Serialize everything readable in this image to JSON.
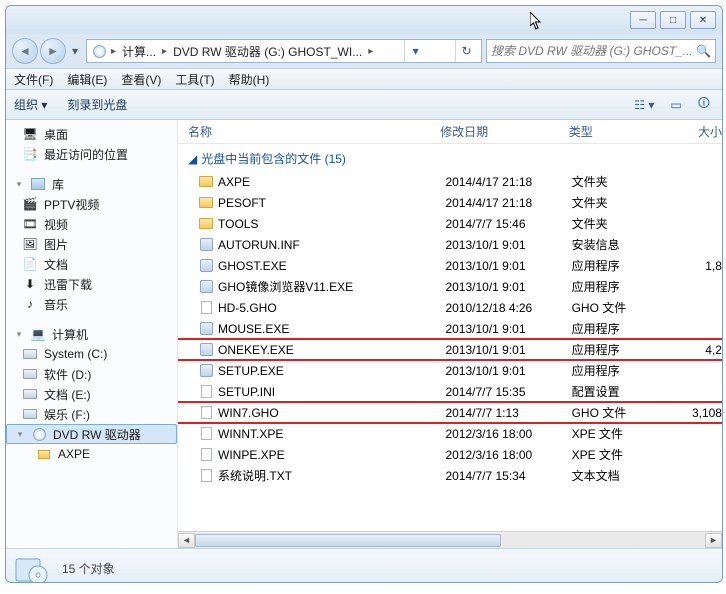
{
  "breadcrumb": {
    "seg1": "计算...",
    "seg2": "DVD RW 驱动器 (G:) GHOST_WI..."
  },
  "search": {
    "placeholder": "搜索 DVD RW 驱动器 (G:) GHOST_..."
  },
  "menu": {
    "file": "文件(F)",
    "edit": "编辑(E)",
    "view": "查看(V)",
    "tools": "工具(T)",
    "help": "帮助(H)"
  },
  "toolbar": {
    "organize": "组织",
    "burn": "刻录到光盘"
  },
  "sidebar": {
    "desktop": "桌面",
    "recent": "最近访问的位置",
    "lib": "库",
    "pptv": "PPTV视频",
    "video": "视频",
    "pictures": "图片",
    "docs": "文档",
    "xunlei": "迅雷下载",
    "music": "音乐",
    "computer": "计算机",
    "sysc": "System (C:)",
    "softd": "软件 (D:)",
    "doce": "文档 (E:)",
    "entf": "娱乐 (F:)",
    "dvdg": "DVD RW 驱动器",
    "axpe": "AXPE"
  },
  "columns": {
    "name": "名称",
    "date": "修改日期",
    "type": "类型",
    "size": "大小"
  },
  "group": {
    "label": "光盘中当前包含的文件 (15)"
  },
  "files": [
    {
      "icon": "folder",
      "name": "AXPE",
      "date": "2014/4/17 21:18",
      "type": "文件夹",
      "size": ""
    },
    {
      "icon": "folder",
      "name": "PESOFT",
      "date": "2014/4/17 21:18",
      "type": "文件夹",
      "size": ""
    },
    {
      "icon": "folder",
      "name": "TOOLS",
      "date": "2014/7/7 15:46",
      "type": "文件夹",
      "size": ""
    },
    {
      "icon": "exe",
      "name": "AUTORUN.INF",
      "date": "2013/10/1 9:01",
      "type": "安装信息",
      "size": ""
    },
    {
      "icon": "exe",
      "name": "GHOST.EXE",
      "date": "2013/10/1 9:01",
      "type": "应用程序",
      "size": "1,8"
    },
    {
      "icon": "exe",
      "name": "GHO镜像浏览器V11.EXE",
      "date": "2013/10/1 9:01",
      "type": "应用程序",
      "size": ""
    },
    {
      "icon": "file",
      "name": "HD-5.GHO",
      "date": "2010/12/18 4:26",
      "type": "GHO 文件",
      "size": ""
    },
    {
      "icon": "exe",
      "name": "MOUSE.EXE",
      "date": "2013/10/1 9:01",
      "type": "应用程序",
      "size": ""
    },
    {
      "icon": "exe",
      "name": "ONEKEY.EXE",
      "date": "2013/10/1 9:01",
      "type": "应用程序",
      "size": "4,2",
      "hl": true
    },
    {
      "icon": "exe",
      "name": "SETUP.EXE",
      "date": "2013/10/1 9:01",
      "type": "应用程序",
      "size": ""
    },
    {
      "icon": "file",
      "name": "SETUP.INI",
      "date": "2014/7/7 15:35",
      "type": "配置设置",
      "size": ""
    },
    {
      "icon": "file",
      "name": "WIN7.GHO",
      "date": "2014/7/7 1:13",
      "type": "GHO 文件",
      "size": "3,108",
      "hl": true
    },
    {
      "icon": "file",
      "name": "WINNT.XPE",
      "date": "2012/3/16 18:00",
      "type": "XPE 文件",
      "size": ""
    },
    {
      "icon": "file",
      "name": "WINPE.XPE",
      "date": "2012/3/16 18:00",
      "type": "XPE 文件",
      "size": ""
    },
    {
      "icon": "file",
      "name": "系统说明.TXT",
      "date": "2014/7/7 15:34",
      "type": "文本文档",
      "size": ""
    }
  ],
  "status": {
    "count": "15 个对象"
  },
  "col_widths": {
    "name": "255px",
    "date": "130px",
    "type": "105px",
    "size": "50px"
  }
}
